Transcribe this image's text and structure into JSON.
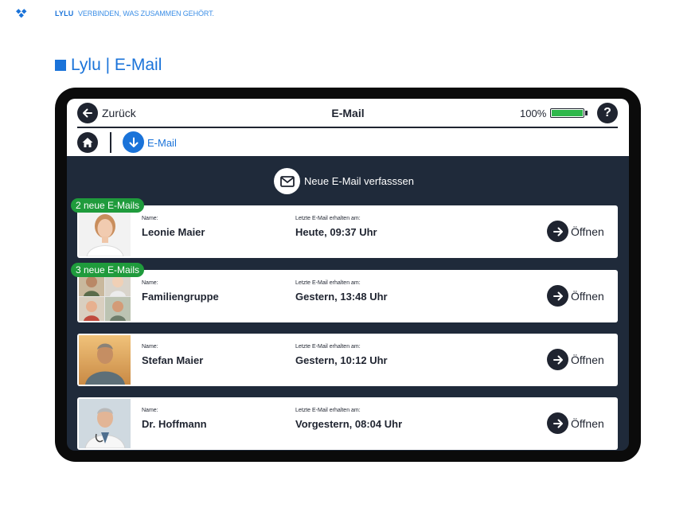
{
  "brand": {
    "name": "LYLU",
    "tagline": "VERBINDEN, WAS ZUSAMMEN GEHÖRT.",
    "color": "#1a73d9"
  },
  "heading": {
    "text": "Lylu | E-Mail"
  },
  "tablet": {
    "topbar": {
      "back_label": "Zurück",
      "title": "E-Mail",
      "battery_text": "100%",
      "battery_level": 1.0,
      "help_label": "?"
    },
    "breadcrumb": {
      "current": "E-Mail"
    },
    "compose_label": "Neue E-Mail verfasssen",
    "emails": [
      {
        "badge": "2 neue E-Mails",
        "name_label": "Name:",
        "name": "Leonie Maier",
        "date_label": "Letzte E-Mail erhalten am:",
        "date": "Heute, 09:37 Uhr",
        "open_label": "Öffnen"
      },
      {
        "badge": "3 neue E-Mails",
        "name_label": "Name:",
        "name": "Familiengruppe",
        "date_label": "Letzte E-Mail erhalten am:",
        "date": "Gestern, 13:48 Uhr",
        "open_label": "Öffnen"
      },
      {
        "badge": "",
        "name_label": "Name:",
        "name": "Stefan Maier",
        "date_label": "Letzte E-Mail erhalten am:",
        "date": "Gestern, 10:12 Uhr",
        "open_label": "Öffnen"
      },
      {
        "badge": "",
        "name_label": "Name:",
        "name": "Dr. Hoffmann",
        "date_label": "Letzte E-Mail erhalten am:",
        "date": "Vorgestern, 08:04 Uhr",
        "open_label": "Öffnen"
      }
    ],
    "colors": {
      "screen": "#1f2a3a",
      "accent": "#1a73d9",
      "badge": "#1f9b3c",
      "battery": "#2fb84c"
    }
  }
}
